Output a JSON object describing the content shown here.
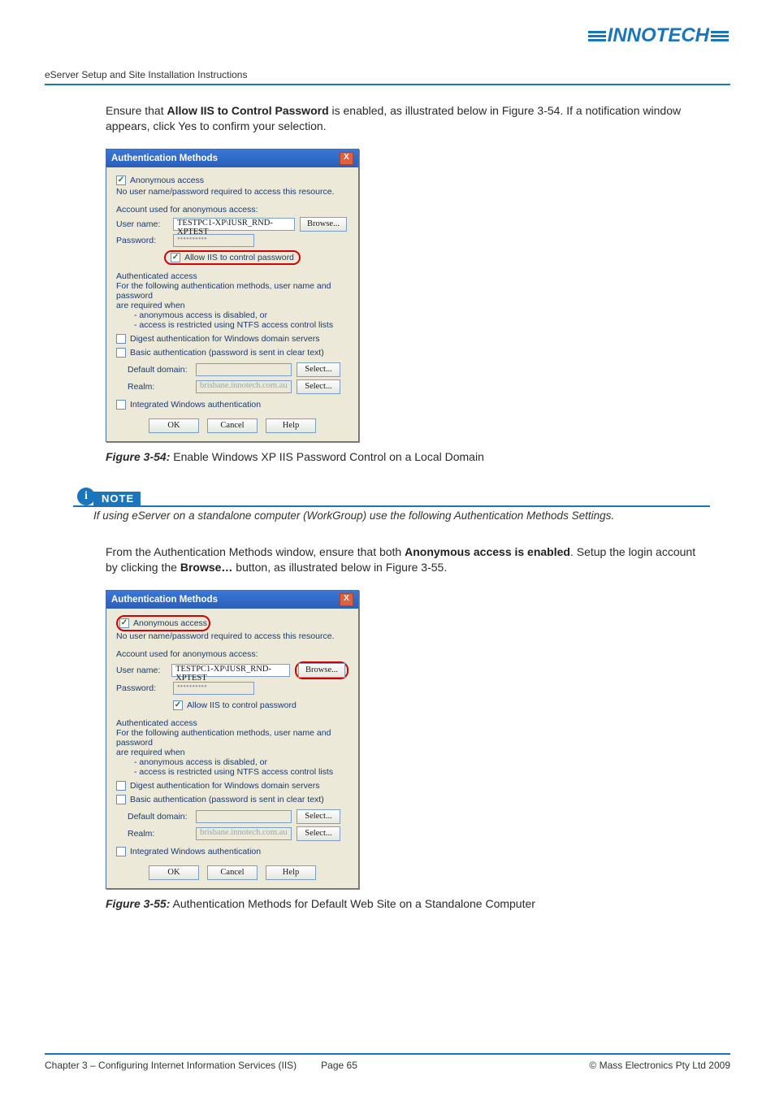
{
  "brand": {
    "name": "INNOTECH"
  },
  "header": {
    "doc_title": "eServer Setup and Site Installation Instructions"
  },
  "para1_a": "Ensure that ",
  "para1_b": "Allow IIS to Control Password",
  "para1_c": " is enabled, as illustrated below in Figure 3-54.  If a notification window appears, click Yes to confirm your selection.",
  "fig1": {
    "label": "Figure 3-54:",
    "caption": "   Enable Windows XP IIS Password Control on a Local Domain"
  },
  "note": {
    "label": "NOTE",
    "text": "If using eServer on a standalone computer (WorkGroup) use the following Authentication Methods Settings."
  },
  "para2_a": "From the Authentication Methods window, ensure that both ",
  "para2_b": "Anonymous access is enabled",
  "para2_c": ".  Setup the login account by clicking the ",
  "para2_d": "Browse…",
  "para2_e": " button, as illustrated below in Figure 3-55.",
  "fig2": {
    "label": "Figure 3-55:",
    "caption": "   Authentication Methods for Default Web Site on a Standalone Computer"
  },
  "dlg": {
    "title": "Authentication Methods",
    "close": "X",
    "anon_chk": "Anonymous access",
    "anon_desc": "No user name/password required to access this resource.",
    "acct_used": "Account used for anonymous access:",
    "user_lbl": "User name:",
    "user_val": "TESTPC1-XP\\IUSR_RND-XPTEST",
    "browse": "Browse...",
    "pass_lbl": "Password:",
    "pass_val": "••••••••••",
    "allow_iis": "Allow IIS to control password",
    "auth_access": "Authenticated access",
    "auth_desc1": "For the following authentication methods, user name and password",
    "auth_desc2": "are required when",
    "bullet1": "- anonymous access is disabled, or",
    "bullet2": "- access is restricted using NTFS access control lists",
    "digest": "Digest authentication for Windows domain servers",
    "basic": "Basic authentication (password is sent in clear text)",
    "def_domain": "Default domain:",
    "realm": "Realm:",
    "realm_val": "brisbane.innotech.com.au",
    "select": "Select...",
    "integrated": "Integrated Windows authentication",
    "ok": "OK",
    "cancel": "Cancel",
    "help": "Help"
  },
  "footer": {
    "chapter": "Chapter 3 – Configuring Internet Information Services (IIS)",
    "page": "Page 65",
    "copyright": "©  Mass Electronics Pty Ltd  2009"
  }
}
